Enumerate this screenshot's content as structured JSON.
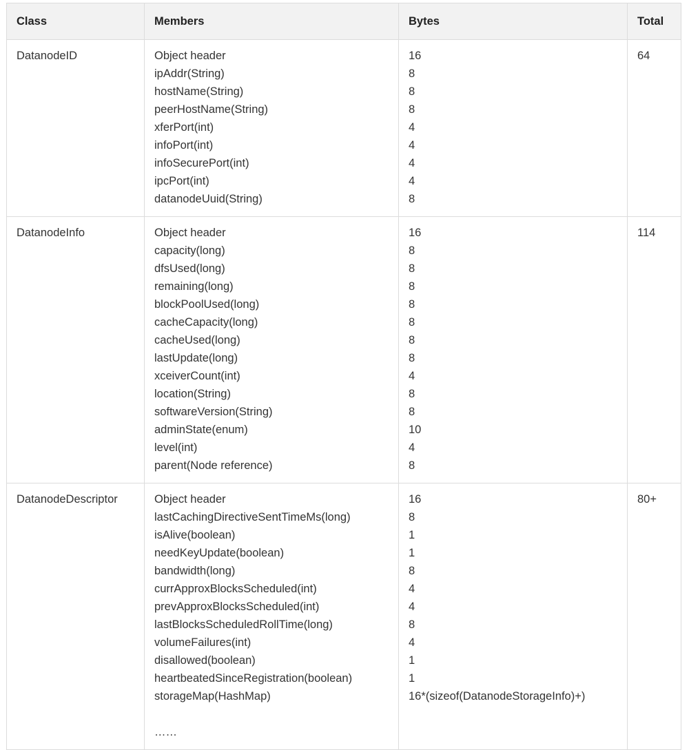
{
  "table": {
    "columns": [
      {
        "key": "class",
        "label": "Class"
      },
      {
        "key": "members",
        "label": "Members"
      },
      {
        "key": "bytes",
        "label": "Bytes"
      },
      {
        "key": "total",
        "label": "Total"
      }
    ],
    "rows": [
      {
        "class": "DatanodeID",
        "members": [
          "Object header",
          "ipAddr(String)",
          "hostName(String)",
          "peerHostName(String)",
          "xferPort(int)",
          "infoPort(int)",
          "infoSecurePort(int)",
          "ipcPort(int)",
          "datanodeUuid(String)"
        ],
        "bytes": [
          "16",
          "8",
          "8",
          "8",
          "4",
          "4",
          "4",
          "4",
          "8"
        ],
        "total": "64"
      },
      {
        "class": "DatanodeInfo",
        "members": [
          "Object header",
          "capacity(long)",
          "dfsUsed(long)",
          "remaining(long)",
          "blockPoolUsed(long)",
          "cacheCapacity(long)",
          "cacheUsed(long)",
          "lastUpdate(long)",
          "xceiverCount(int)",
          "location(String)",
          "softwareVersion(String)",
          "adminState(enum)",
          "level(int)",
          "parent(Node reference)"
        ],
        "bytes": [
          "16",
          "8",
          "8",
          "8",
          "8",
          "8",
          "8",
          "8",
          "4",
          "8",
          "8",
          "10",
          "4",
          "8"
        ],
        "total": "114"
      },
      {
        "class": "DatanodeDescriptor",
        "members": [
          "Object header",
          "lastCachingDirectiveSentTimeMs(long)",
          "isAlive(boolean)",
          "needKeyUpdate(boolean)",
          "bandwidth(long)",
          "currApproxBlocksScheduled(int)",
          "prevApproxBlocksScheduled(int)",
          "lastBlocksScheduledRollTime(long)",
          "volumeFailures(int)",
          "disallowed(boolean)",
          "heartbeatedSinceRegistration(boolean)",
          "storageMap(HashMap)",
          "",
          "……"
        ],
        "bytes": [
          "16",
          "8",
          "1",
          "1",
          "8",
          "4",
          "4",
          "8",
          "4",
          "1",
          "1",
          "16*(sizeof(DatanodeStorageInfo)+)"
        ],
        "total": "80+"
      }
    ]
  },
  "colors": {
    "header_background": "#f2f2f2",
    "border": "#dcdcdc",
    "text": "#333333",
    "page_background": "#ffffff"
  }
}
